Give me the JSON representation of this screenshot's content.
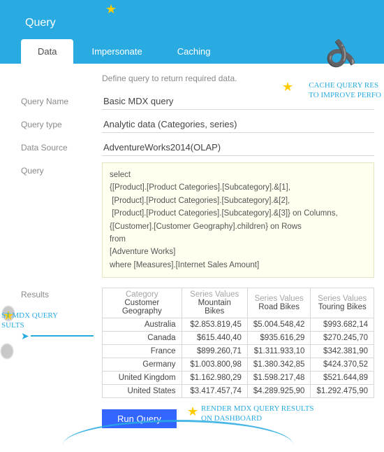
{
  "header": {
    "title": "Query"
  },
  "tabs": {
    "data": "Data",
    "impersonate": "Impersonate",
    "caching": "Caching"
  },
  "helper": "Define query to return required data.",
  "labels": {
    "query_name": "Query Name",
    "query_type": "Query type",
    "data_source": "Data Source",
    "query": "Query",
    "results": "Results"
  },
  "fields": {
    "query_name": "Basic MDX query",
    "query_type": "Analytic data (Categories, series)",
    "data_source": "AdventureWorks2014(OLAP)",
    "query": "select\n{[Product].[Product Categories].[Subcategory].&[1],\n [Product].[Product Categories].[Subcategory].&[2],\n [Product].[Product Categories].[Subcategory].&[3]} on Columns,\n{[Customer].[Customer Geography].children} on Rows\nfrom\n[Adventure Works]\nwhere [Measures].[Internet Sales Amount]"
  },
  "results": {
    "headers": {
      "category": "Category",
      "category_sub": "Customer Geography",
      "series": "Series Values",
      "s1": "Mountain Bikes",
      "s2": "Road Bikes",
      "s3": "Touring Bikes"
    },
    "rows": [
      {
        "geo": "Australia",
        "v1": "$2.853.819,45",
        "v2": "$5.004.548,42",
        "v3": "$993.682,14"
      },
      {
        "geo": "Canada",
        "v1": "$615.440,40",
        "v2": "$935.616,29",
        "v3": "$270.245,70"
      },
      {
        "geo": "France",
        "v1": "$899.260,71",
        "v2": "$1.311.933,10",
        "v3": "$342.381,90"
      },
      {
        "geo": "Germany",
        "v1": "$1.003.800,98",
        "v2": "$1.380.342,85",
        "v3": "$424.370,52"
      },
      {
        "geo": "United Kingdom",
        "v1": "$1.162.980,29",
        "v2": "$1.598.217,48",
        "v3": "$521.644,89"
      },
      {
        "geo": "United States",
        "v1": "$3.417.457,74",
        "v2": "$4.289.925,90",
        "v3": "$1.292.475,90"
      }
    ]
  },
  "buttons": {
    "run": "Run Query"
  },
  "annotations": {
    "cache": "CACHE QUERY RES\nTO IMPROVE PERFO",
    "testmdx": "ST MDX QUERY\nSULTS",
    "render": "RENDER MDX QUERY RESULTS\nON DASHBOARD"
  }
}
